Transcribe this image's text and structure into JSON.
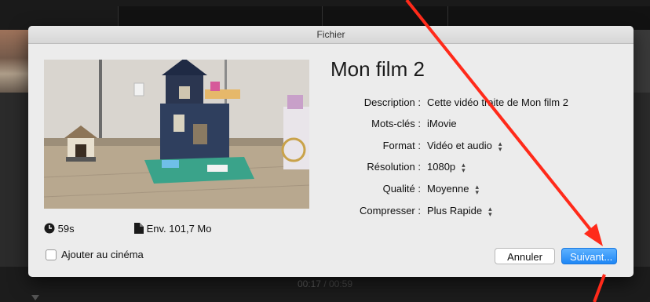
{
  "dialog": {
    "title": "Fichier",
    "movie_title": "Mon film 2",
    "duration": "59s",
    "file_size": "Env. 101,7 Mo",
    "fields": [
      {
        "label": "Description :",
        "value": "Cette vidéo traite de Mon film 2",
        "stepper": false
      },
      {
        "label": "Mots-clés :",
        "value": "iMovie",
        "stepper": false
      },
      {
        "label": "Format :",
        "value": "Vidéo et audio",
        "stepper": true
      },
      {
        "label": "Résolution :",
        "value": "1080p",
        "stepper": true
      },
      {
        "label": "Qualité :",
        "value": "Moyenne",
        "stepper": true
      },
      {
        "label": "Compresser :",
        "value": "Plus Rapide",
        "stepper": true
      }
    ],
    "checkbox_label": "Ajouter au cinéma",
    "checkbox_checked": false,
    "cancel_label": "Annuler",
    "next_label": "Suivant..."
  },
  "background": {
    "current_time": "00:17",
    "separator": " / ",
    "total_time": "00:59"
  },
  "colors": {
    "annotation_arrow": "#ff2a1a",
    "primary_button": "#1e86f5"
  },
  "icons": {
    "duration": "clock-icon",
    "size": "document-icon",
    "stepper": "updown-chevron-icon"
  }
}
